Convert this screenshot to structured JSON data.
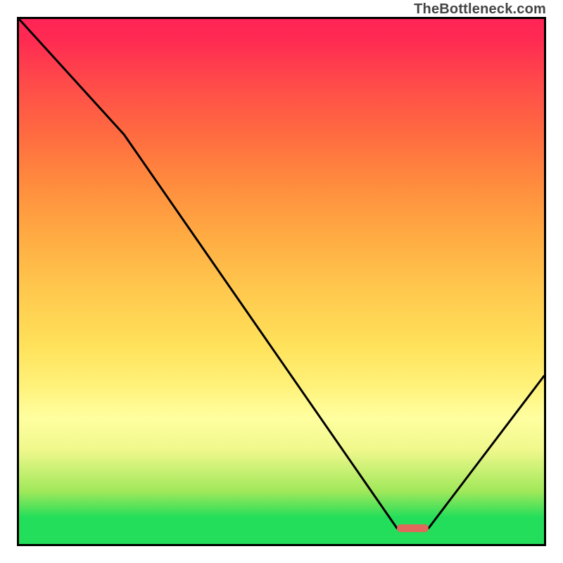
{
  "attribution": "TheBottleneck.com",
  "chart_data": {
    "type": "line",
    "title": "",
    "xlabel": "",
    "ylabel": "",
    "ylim": [
      0,
      100
    ],
    "xlim": [
      0,
      100
    ],
    "series": [
      {
        "name": "bottleneck-curve",
        "x": [
          0,
          20,
          72,
          78,
          100
        ],
        "y": [
          100,
          78,
          3,
          3,
          32
        ]
      }
    ],
    "marker": {
      "name": "optimal-range",
      "x_range": [
        72,
        78
      ],
      "y": 3,
      "color": "#e3685c"
    },
    "gradient_bands_percent_from_bottom": [
      {
        "pct": 0,
        "color": "#22de5a"
      },
      {
        "pct": 5,
        "color": "#22de5a"
      },
      {
        "pct": 10,
        "color": "#a0e85a"
      },
      {
        "pct": 18,
        "color": "#f0f88c"
      },
      {
        "pct": 24,
        "color": "#ffffa0"
      },
      {
        "pct": 30,
        "color": "#fff27a"
      },
      {
        "pct": 38,
        "color": "#ffe15a"
      },
      {
        "pct": 48,
        "color": "#ffc94e"
      },
      {
        "pct": 58,
        "color": "#ffad43"
      },
      {
        "pct": 68,
        "color": "#ff8e3e"
      },
      {
        "pct": 78,
        "color": "#ff6b40"
      },
      {
        "pct": 88,
        "color": "#ff4a4a"
      },
      {
        "pct": 96,
        "color": "#ff2a52"
      },
      {
        "pct": 100,
        "color": "#ff2456"
      }
    ]
  },
  "colors": {
    "curve": "#000000",
    "marker": "#e3685c",
    "border": "#000000",
    "attribution": "#444444"
  }
}
